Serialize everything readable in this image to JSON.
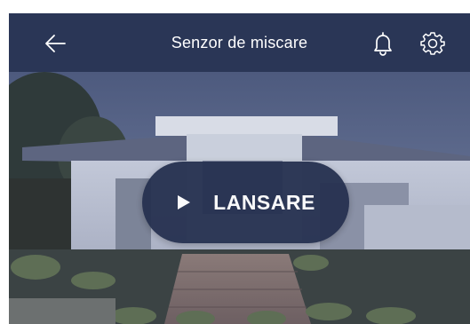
{
  "header": {
    "title": "Senzor de miscare",
    "back_icon": "arrow-left-icon",
    "bell_icon": "bell-icon",
    "settings_icon": "gear-icon"
  },
  "preview": {
    "image": "house-exterior-photo",
    "launch_label": "LANSARE",
    "play_icon": "play-icon"
  },
  "colors": {
    "header_bg": "#2a3656",
    "button_bg": "#263150",
    "text": "#ffffff"
  }
}
